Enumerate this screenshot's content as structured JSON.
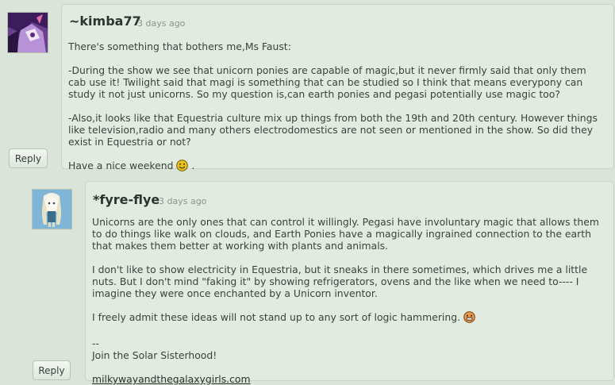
{
  "comments": [
    {
      "author": "~kimba77",
      "timestamp": "3 days ago",
      "reply_label": "Reply",
      "lines": [
        "There's something that bothers me,Ms Faust:",
        "",
        "-During the show we see that unicorn ponies are capable of magic,but it never firmly said that only them",
        "cab use it! Twilight said that magi is something that can be studied so I think that means everypony can",
        "study it not just unicorns. So my question is,can earth ponies and pegasi potentially use magic too?",
        "",
        "-Also,it looks like that Equestria culture mix up things from both the 19th and 20th century. However things",
        "like television,radio and many others electrodomestics are not seen or mentioned in the show. So did they",
        "exist in Equestria or not?",
        ""
      ],
      "closing_text": "Have a nice weekend",
      "closing_suffix": " .",
      "emoticon": "smiley-icon"
    },
    {
      "author": "*fyre-flye",
      "timestamp": "3 days ago",
      "reply_label": "Reply",
      "lines": [
        "Unicorns are the only ones that can control it willingly. Pegasi have involuntary magic that allows them",
        "to do things like walk on clouds, and Earth Ponies have a magically ingrained connection to the earth",
        "that makes them better at working with plants and animals.",
        "",
        "I don't like to show electricity in Equestria, but it sneaks in there sometimes, which drives me a little",
        "nuts. But I don't mind \"faking it\" by showing refrigerators, ovens and the like when we need to---- I",
        "imagine they were once enchanted by a Unicorn inventor.",
        ""
      ],
      "closing_text": "I freely admit these ideas will not stand up to any sort of logic hammering.",
      "emoticon": "grin-icon",
      "signature_dash": "--",
      "signature_text": "Join the Solar Sisterhood!",
      "signature_link": "milkywayandthegalaxygirls.com"
    }
  ],
  "colors": {
    "background": "#dae4d9",
    "card": "#e2ebe0",
    "author": "#2a3530",
    "timestamp": "#8a968c"
  }
}
